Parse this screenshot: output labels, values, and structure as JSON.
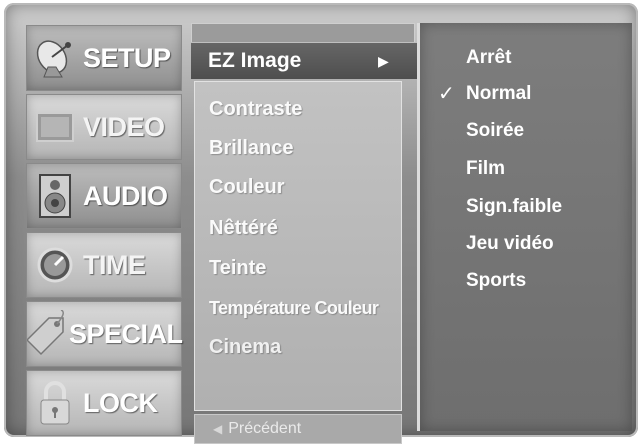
{
  "tabs": [
    {
      "label": "SETUP",
      "icon": "satellite-dish-icon"
    },
    {
      "label": "VIDEO",
      "icon": "screen-icon"
    },
    {
      "label": "AUDIO",
      "icon": "speaker-icon"
    },
    {
      "label": "TIME",
      "icon": "clock-icon"
    },
    {
      "label": "SPECIAL",
      "icon": "tag-icon"
    },
    {
      "label": "LOCK",
      "icon": "padlock-icon"
    }
  ],
  "menu": {
    "selected": {
      "label": "EZ Image",
      "arrow": "▶"
    },
    "items": [
      "Contraste",
      "Brillance",
      "Couleur",
      "Nêttéré",
      "Teinte",
      "Température Couleur",
      "Cinema"
    ],
    "back_label": "Précédent",
    "back_icon": "◀"
  },
  "submenu": {
    "options": [
      "Arrêt",
      "Normal",
      "Soirée",
      "Film",
      "Sign.faible",
      "Jeu vidéo",
      "Sports"
    ],
    "checked_index": 1,
    "check_mark": "✓"
  }
}
